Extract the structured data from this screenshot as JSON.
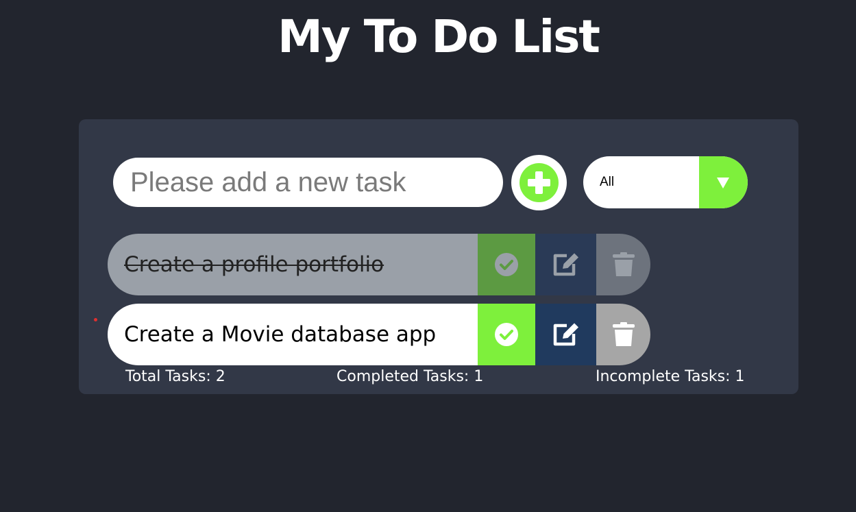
{
  "header": {
    "title": "My To Do List"
  },
  "new_task": {
    "placeholder": "Please add a new task",
    "value": "",
    "add_icon": "plus-circle-icon"
  },
  "filter": {
    "selected": "All",
    "arrow_icon": "caret-down-icon"
  },
  "todos": [
    {
      "text": "Create a profile portfolio",
      "completed": true
    },
    {
      "text": "Create a Movie database app",
      "completed": false
    }
  ],
  "stats": {
    "total_label": "Total Tasks: 2",
    "completed_label": "Completed Tasks: 1",
    "incomplete_label": "Incomplete Tasks: 1"
  },
  "colors": {
    "background": "#22252e",
    "card": "#323847",
    "accent_green": "#7ef03c",
    "edit_blue": "#203a5e",
    "trash_gray": "#a6a6a6"
  }
}
